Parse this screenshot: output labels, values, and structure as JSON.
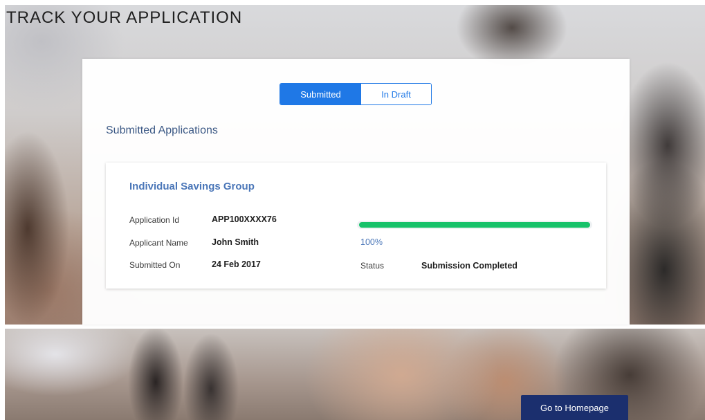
{
  "page": {
    "title": "TRACK YOUR APPLICATION"
  },
  "tabs": [
    {
      "label": "Submitted",
      "active": true
    },
    {
      "label": "In Draft",
      "active": false
    }
  ],
  "section_title": "Submitted Applications",
  "application": {
    "group_name": "Individual Savings Group",
    "fields": [
      {
        "label": "Application Id",
        "value": "APP100XXXX76"
      },
      {
        "label": "Applicant Name",
        "value": "John Smith"
      },
      {
        "label": "Submitted On",
        "value": "24 Feb 2017"
      }
    ],
    "progress": {
      "percent_label": "100%",
      "fraction": 1.0
    },
    "status": {
      "label": "Status",
      "value": "Submission Completed"
    }
  },
  "footer": {
    "home_button_label": "Go to Homepage"
  },
  "colors": {
    "accent": "#1f78e6",
    "progress": "#17c26a",
    "primary_button": "#1b2f6e",
    "link_text": "#4a76b8"
  }
}
